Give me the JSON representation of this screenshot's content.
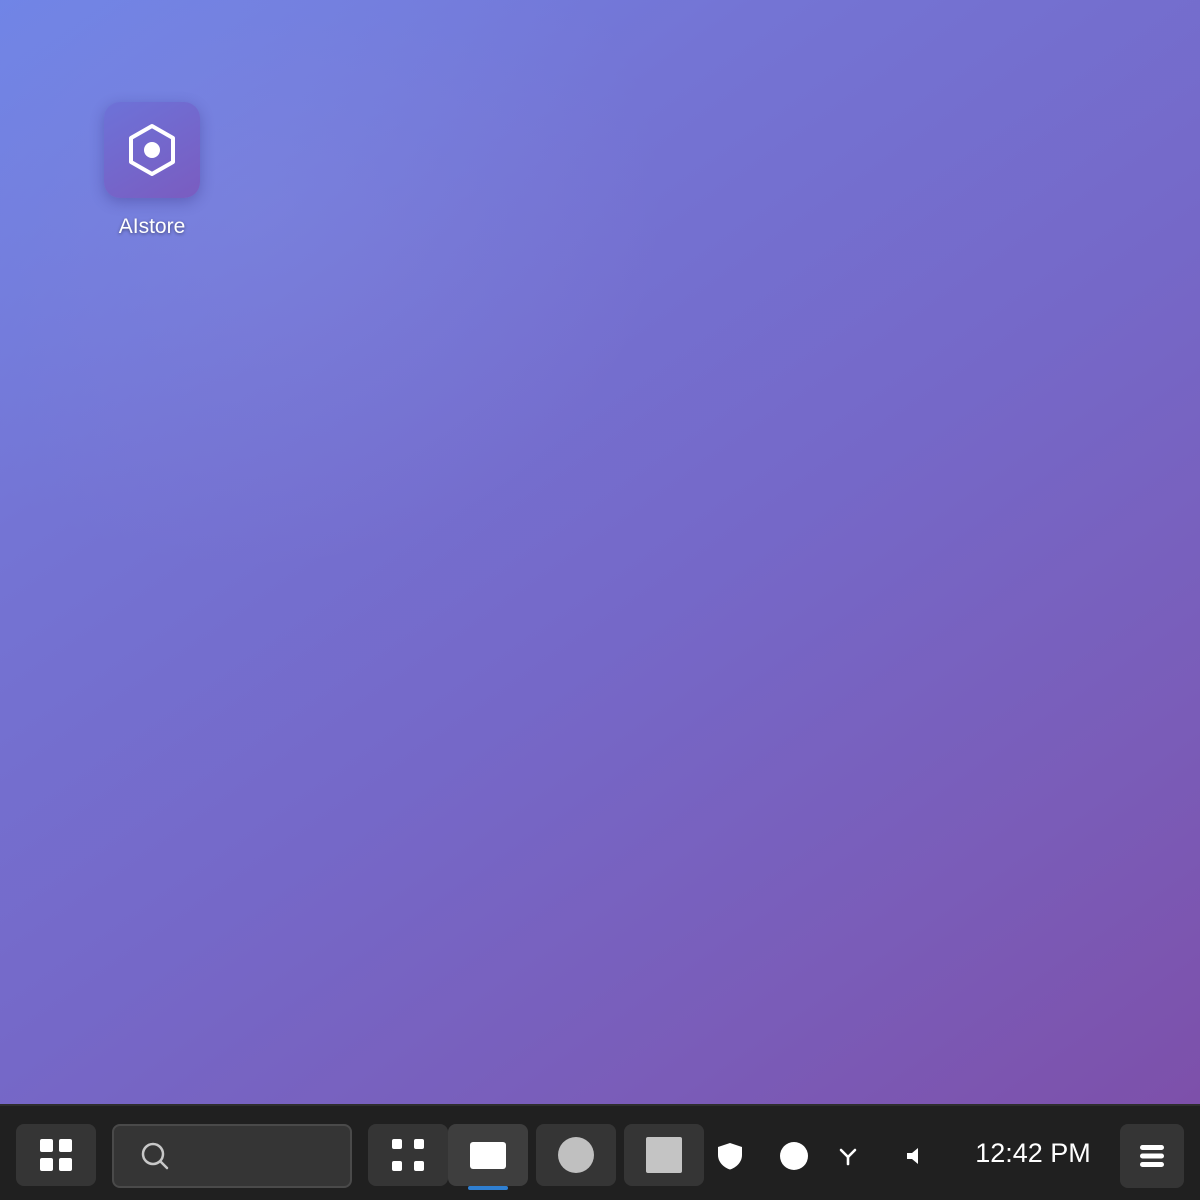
{
  "desktop": {
    "icons": [
      {
        "label": "AIstore",
        "icon": "hexagon-icon"
      }
    ]
  },
  "taskbar": {
    "start": {
      "icon": "grid-icon"
    },
    "search": {
      "icon": "search-icon",
      "placeholder": ""
    },
    "task_view": {
      "icon": "grid-icon"
    },
    "apps": [
      {
        "icon": "window-icon",
        "active": true
      },
      {
        "icon": "circle-icon",
        "active": false
      },
      {
        "icon": "square-icon",
        "active": false
      }
    ],
    "tray": [
      {
        "icon": "shield-icon"
      },
      {
        "icon": "circle-icon"
      },
      {
        "icon": "network-icon"
      },
      {
        "icon": "volume-icon"
      }
    ],
    "clock": "12:42 PM",
    "menu": {
      "icon": "menu-icon"
    }
  },
  "colors": {
    "taskbar_bg": "#202020",
    "button_bg": "#353535",
    "active_indicator": "#2f7fd1",
    "wallpaper_start": "#6f84e6",
    "wallpaper_end": "#7d50aa"
  }
}
